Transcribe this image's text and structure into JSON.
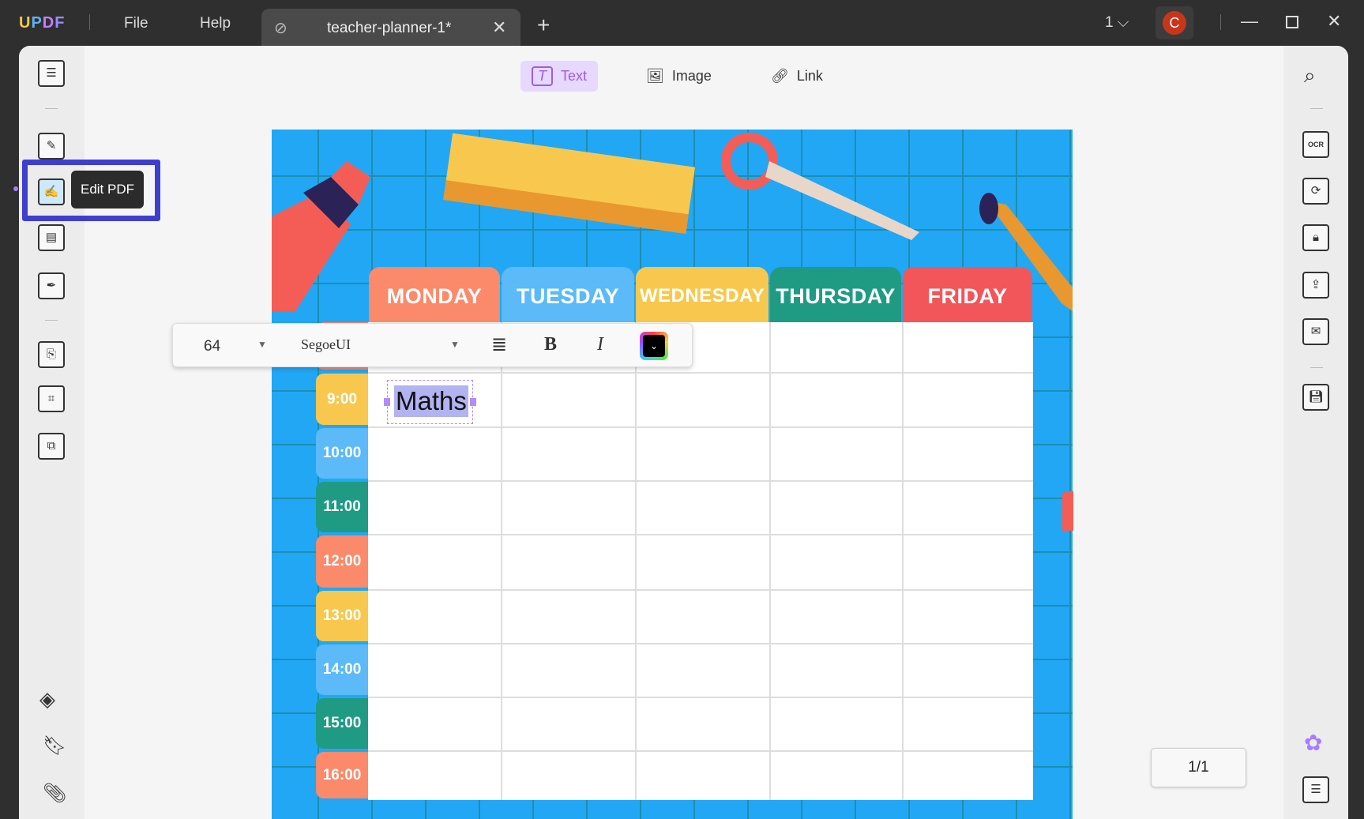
{
  "app": {
    "logo": "UPDF",
    "menu": [
      "File",
      "Help"
    ],
    "tab_title": "teacher-planner-1*",
    "page_select": "1",
    "avatar": "C"
  },
  "toolbar": {
    "items": [
      {
        "label": "Text",
        "active": true
      },
      {
        "label": "Image"
      },
      {
        "label": "Link"
      }
    ]
  },
  "sidebar": {
    "tooltip": "Edit PDF"
  },
  "format_bar": {
    "font_size": "64",
    "font_family": "SegoeUI",
    "bold": "B",
    "italic": "I"
  },
  "planner": {
    "days": [
      {
        "label": "MONDAY",
        "color": "#fb8a6b"
      },
      {
        "label": "TUESDAY",
        "color": "#5bbaf7"
      },
      {
        "label": "WEDNESDAY",
        "color": "#f8c84e"
      },
      {
        "label": "THURSDAY",
        "color": "#1f9b84"
      },
      {
        "label": "FRIDAY",
        "color": "#f2565a"
      }
    ],
    "times": [
      {
        "label": "9:00",
        "color": "#f8c84e"
      },
      {
        "label": "10:00",
        "color": "#5bbaf7"
      },
      {
        "label": "11:00",
        "color": "#1f9b84"
      },
      {
        "label": "12:00",
        "color": "#fb8a6b"
      },
      {
        "label": "13:00",
        "color": "#f8c84e"
      },
      {
        "label": "14:00",
        "color": "#5bbaf7"
      },
      {
        "label": "15:00",
        "color": "#1f9b84"
      },
      {
        "label": "16:00",
        "color": "#fb8a6b"
      }
    ],
    "selected_text": "Maths"
  },
  "page_indicator": "1/1"
}
